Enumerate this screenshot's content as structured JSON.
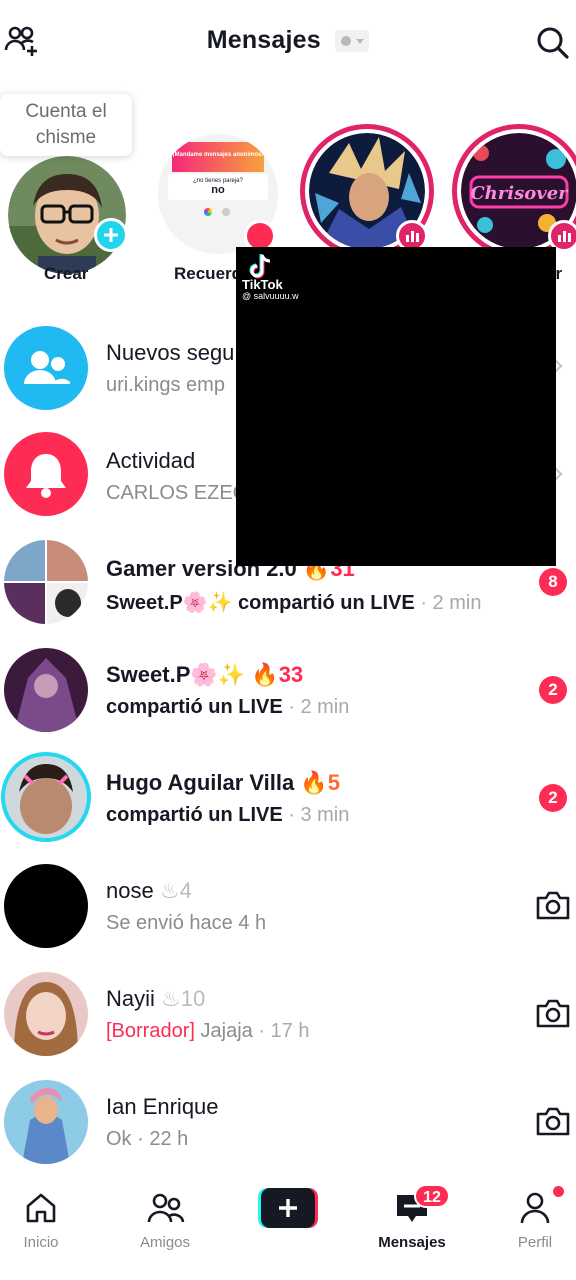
{
  "header": {
    "title": "Mensajes",
    "add_friend_icon": "add-friend-icon",
    "search_icon": "search-icon"
  },
  "tooltip": {
    "text_line1": "Cuenta el",
    "text_line2": "chisme"
  },
  "stories": [
    {
      "label": "Crear",
      "card_text_1": "",
      "card_text_2": ""
    },
    {
      "label": "Recuerd",
      "card_header": "¡Mandame mensajes anonimos!",
      "card_question": "¿no tienes pareja?",
      "card_answer": "no"
    },
    {
      "label": "",
      "art_text": ""
    },
    {
      "label": "er",
      "art_text": "Chrisover"
    }
  ],
  "video_overlay": {
    "brand": "TikTok",
    "username": "@ salvuuuu.w"
  },
  "rows": [
    {
      "name": "Nuevos segu",
      "sub": "uri.kings emp",
      "type": "system",
      "icon": "people-icon",
      "color": "#20b9f2"
    },
    {
      "name": "Actividad",
      "sub": "CARLOS EZEQ",
      "type": "system",
      "icon": "bell-icon",
      "color": "#fe2c55"
    },
    {
      "name": "Gamer version 2.0",
      "streak": "31",
      "sub_bold": "Sweet.P🌸✨ compartió un LIVE",
      "sub_time": "· 2 min",
      "badge": "8"
    },
    {
      "name": "Sweet.P🌸✨",
      "streak": "33",
      "sub_bold": "compartió un LIVE",
      "sub_time": "· 2 min",
      "badge": "2"
    },
    {
      "name": "Hugo Aguilar Villa",
      "streak": "5",
      "sub_bold": "compartió un LIVE",
      "sub_time": "· 3 min",
      "badge": "2"
    },
    {
      "name": "nose",
      "streak": "4",
      "sub": "Se envió hace 4 h"
    },
    {
      "name": "Nayii",
      "streak": "10",
      "draft": "[Borrador]",
      "sub": "Jajaja",
      "sub_time": "· 17 h"
    },
    {
      "name": "Ian Enrique",
      "sub": "Ok · 22 h"
    }
  ],
  "nav": {
    "home": "Inicio",
    "friends": "Amigos",
    "messages": "Mensajes",
    "messages_badge": "12",
    "profile": "Perfil"
  },
  "colors": {
    "accent": "#fe2c55",
    "teal": "#25f4ee",
    "text": "#161823",
    "muted": "#8a8b91"
  }
}
